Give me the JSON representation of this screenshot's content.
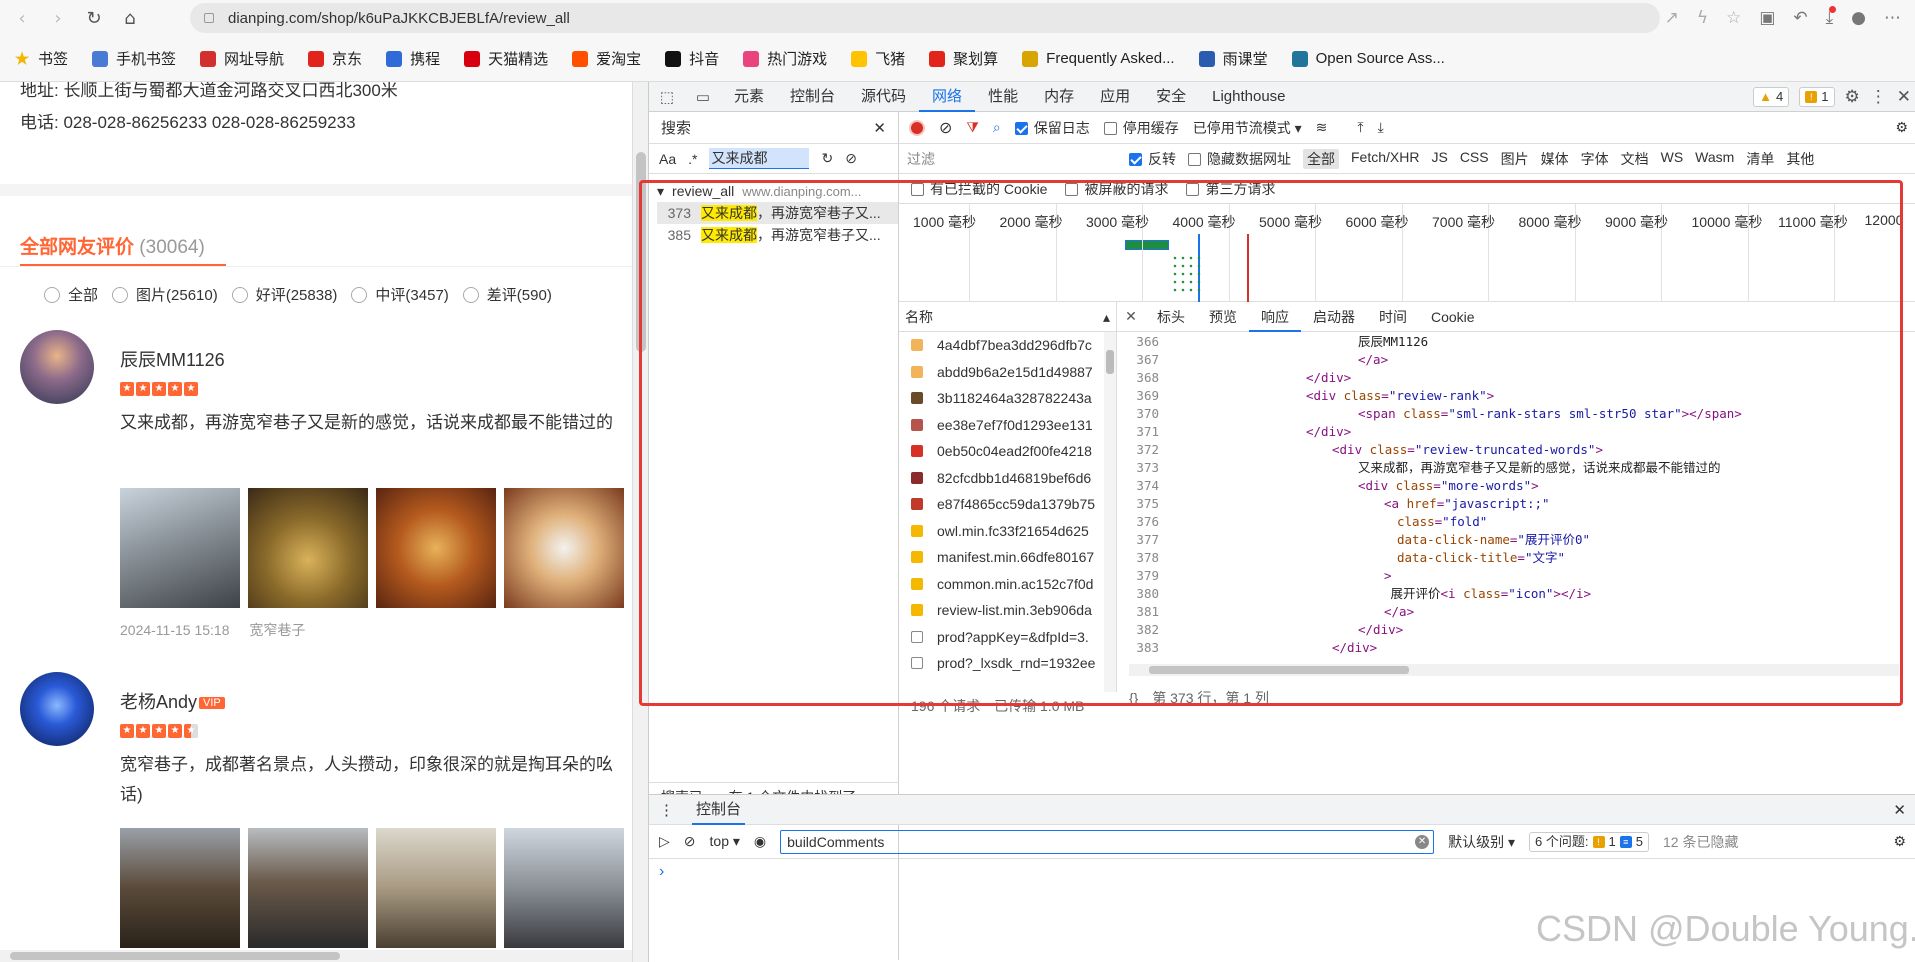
{
  "browser": {
    "url": "dianping.com/shop/k6uPaJKKCBJEBLfA/review_all",
    "bookmarks": [
      {
        "label": "书签",
        "color": "#f4b400"
      },
      {
        "label": "手机书签",
        "color": "#4a7bd4"
      },
      {
        "label": "网址导航",
        "color": "#d32f2f"
      },
      {
        "label": "京东",
        "color": "#e1251b"
      },
      {
        "label": "携程",
        "color": "#2f6bd8"
      },
      {
        "label": "天猫精选",
        "color": "#d8000f"
      },
      {
        "label": "爱淘宝",
        "color": "#ff5000"
      },
      {
        "label": "抖音",
        "color": "#111111"
      },
      {
        "label": "热门游戏",
        "color": "#e9447e"
      },
      {
        "label": "飞猪",
        "color": "#ffc300"
      },
      {
        "label": "聚划算",
        "color": "#e1251b"
      },
      {
        "label": "Frequently Asked...",
        "color": "#d8a400"
      },
      {
        "label": "雨课堂",
        "color": "#2a5db0"
      },
      {
        "label": "Open Source Ass...",
        "color": "#21759b"
      }
    ]
  },
  "page": {
    "address_line": "地址: 长顺上街与蜀都大道金河路交叉口西北300米",
    "phone_line": "电话: 028-028-86256233 028-028-86259233",
    "review_title": "全部网友评价",
    "review_count": "(30064)",
    "filters": [
      "全部",
      "图片(25610)",
      "好评(25838)",
      "中评(3457)",
      "差评(590)"
    ],
    "reviews": [
      {
        "user": "辰辰MM1126",
        "vip": "",
        "rating": 5,
        "text": "又来成都，再游宽窄巷子又是新的感觉，话说来成都最不能错过的",
        "text2": "",
        "date": "2024-11-15 15:18",
        "place": "宽窄巷子"
      },
      {
        "user": "老杨Andy",
        "vip": "VIP",
        "rating": 4.5,
        "text": "宽窄巷子，成都著名景点，人头攒动，印象很深的就是掏耳朵的吆",
        "text2": "话)",
        "date": "",
        "place": ""
      }
    ]
  },
  "devtools": {
    "tabs": [
      "元素",
      "控制台",
      "源代码",
      "网络",
      "性能",
      "内存",
      "应用",
      "安全",
      "Lighthouse"
    ],
    "active_tab": "网络",
    "warnings": "4",
    "issues": "1",
    "search": {
      "title": "搜索",
      "case_label": "Aa",
      "regex_label": ".*",
      "query": "又来成都",
      "file": "review_all",
      "domain": "www.dianping.com...",
      "hits": [
        {
          "line": "373",
          "match": "又来成都",
          "rest": "，再游宽窄巷子又..."
        },
        {
          "line": "385",
          "match": "又来成都",
          "rest": "，再游宽窄巷子又..."
        }
      ],
      "footer_a": "搜索已...",
      "footer_b": "在 1 个文件中找到了 ..."
    },
    "network": {
      "preserve_log": "保留日志",
      "disable_cache": "停用缓存",
      "throttle": "已停用节流模式",
      "filter_placeholder": "过滤",
      "invert": "反转",
      "hide_data_urls": "隐藏数据网址",
      "types": [
        "全部",
        "Fetch/XHR",
        "JS",
        "CSS",
        "图片",
        "媒体",
        "字体",
        "文档",
        "WS",
        "Wasm",
        "清单",
        "其他"
      ],
      "blocked_cookies": "有已拦截的 Cookie",
      "blocked_requests": "被屏蔽的请求",
      "third_party": "第三方请求",
      "timeline_ticks": [
        "1000 毫秒",
        "2000 毫秒",
        "3000 毫秒",
        "4000 毫秒",
        "5000 毫秒",
        "6000 毫秒",
        "7000 毫秒",
        "8000 毫秒",
        "9000 毫秒",
        "10000 毫秒",
        "11000 毫秒",
        "12000"
      ],
      "name_header": "名称",
      "requests": [
        {
          "name": "4a4dbf7bea3dd296dfb7c",
          "icon_color": "#f2b45a"
        },
        {
          "name": "abdd9b6a2e15d1d49887",
          "icon_color": "#f2b45a"
        },
        {
          "name": "3b1182464a328782243a",
          "icon_color": "#6b4a2a"
        },
        {
          "name": "ee38e7ef7f0d1293ee131",
          "icon_color": "#b5544a"
        },
        {
          "name": "0eb50c04ead2f00fe4218",
          "icon_color": "#d93025"
        },
        {
          "name": "82cfcdbb1d46819bef6d6",
          "icon_color": "#8a2c2c"
        },
        {
          "name": "e87f4865cc59da1379b75",
          "icon_color": "#c0392b"
        },
        {
          "name": "owl.min.fc33f21654d625",
          "icon_color": "#f5b800"
        },
        {
          "name": "manifest.min.66dfe80167",
          "icon_color": "#f5b800"
        },
        {
          "name": "common.min.ac152c7f0d",
          "icon_color": "#f5b800"
        },
        {
          "name": "review-list.min.3eb906da",
          "icon_color": "#f5b800"
        },
        {
          "name": "prod?appKey=&dfpId=3.",
          "icon_color": "#ffffff"
        },
        {
          "name": "prod?_lxsdk_rnd=1932ee",
          "icon_color": "#ffffff"
        }
      ],
      "status_a": "196 个请求",
      "status_b": "已传输 1.0 MB",
      "detail_tabs": [
        "标头",
        "预览",
        "响应",
        "启动器",
        "时间",
        "Cookie"
      ],
      "active_detail_tab": "响应",
      "cursor_pos": "第 373 行，第 1 列",
      "code_lines": [
        {
          "n": "366",
          "indent": 30,
          "parts": [
            [
              "tx",
              "辰辰MM1126"
            ]
          ]
        },
        {
          "n": "367",
          "indent": 30,
          "parts": [
            [
              "tg",
              "</a>"
            ]
          ]
        },
        {
          "n": "368",
          "indent": 22,
          "parts": [
            [
              "tg",
              "</div>"
            ]
          ]
        },
        {
          "n": "369",
          "indent": 22,
          "parts": [
            [
              "tg",
              "<div "
            ],
            [
              "at",
              "class"
            ],
            [
              "tg",
              "="
            ],
            [
              "av",
              "\"review-rank\""
            ],
            [
              "tg",
              ">"
            ]
          ]
        },
        {
          "n": "370",
          "indent": 30,
          "parts": [
            [
              "tg",
              "<span "
            ],
            [
              "at",
              "class"
            ],
            [
              "tg",
              "="
            ],
            [
              "av",
              "\"sml-rank-stars sml-str50 star\""
            ],
            [
              "tg",
              "></span>"
            ]
          ]
        },
        {
          "n": "371",
          "indent": 22,
          "parts": [
            [
              "tg",
              "</div>"
            ]
          ]
        },
        {
          "n": "372",
          "indent": 26,
          "parts": [
            [
              "tg",
              "<div "
            ],
            [
              "at",
              "class"
            ],
            [
              "tg",
              "="
            ],
            [
              "av",
              "\"review-truncated-words\""
            ],
            [
              "tg",
              ">"
            ]
          ]
        },
        {
          "n": "373",
          "indent": 30,
          "parts": [
            [
              "tx",
              "又来成都，再游宽窄巷子又是新的感觉，话说来成都最不能错过的"
            ]
          ]
        },
        {
          "n": "374",
          "indent": 30,
          "parts": [
            [
              "tg",
              "<div "
            ],
            [
              "at",
              "class"
            ],
            [
              "tg",
              "="
            ],
            [
              "av",
              "\"more-words\""
            ],
            [
              "tg",
              ">"
            ]
          ]
        },
        {
          "n": "375",
          "indent": 34,
          "parts": [
            [
              "tg",
              "<a "
            ],
            [
              "at",
              "href"
            ],
            [
              "tg",
              "="
            ],
            [
              "av",
              "\"javascript:;\""
            ]
          ]
        },
        {
          "n": "376",
          "indent": 36,
          "parts": [
            [
              "at",
              "class"
            ],
            [
              "tg",
              "="
            ],
            [
              "av",
              "\"fold\""
            ]
          ]
        },
        {
          "n": "377",
          "indent": 36,
          "parts": [
            [
              "at",
              "data-click-name"
            ],
            [
              "tg",
              "="
            ],
            [
              "av",
              "\"展开评价0\""
            ]
          ]
        },
        {
          "n": "378",
          "indent": 36,
          "parts": [
            [
              "at",
              "data-click-title"
            ],
            [
              "tg",
              "="
            ],
            [
              "av",
              "\"文字\""
            ]
          ]
        },
        {
          "n": "379",
          "indent": 34,
          "parts": [
            [
              "tg",
              ">"
            ]
          ]
        },
        {
          "n": "380",
          "indent": 35,
          "parts": [
            [
              "tx",
              "展开评价"
            ],
            [
              "tg",
              "<i "
            ],
            [
              "at",
              "class"
            ],
            [
              "tg",
              "="
            ],
            [
              "av",
              "\"icon\""
            ],
            [
              "tg",
              "></i>"
            ]
          ]
        },
        {
          "n": "381",
          "indent": 34,
          "parts": [
            [
              "tg",
              "</a>"
            ]
          ]
        },
        {
          "n": "382",
          "indent": 30,
          "parts": [
            [
              "tg",
              "</div>"
            ]
          ]
        },
        {
          "n": "383",
          "indent": 26,
          "parts": [
            [
              "tg",
              "</div>"
            ]
          ]
        }
      ]
    },
    "console": {
      "title": "控制台",
      "context": "top",
      "filter_value": "buildComments",
      "level": "默认级别",
      "issues_label": "6 个问题:",
      "issues_warn": "1",
      "issues_info": "5",
      "hidden": "12 条已隐藏",
      "prompt": "›"
    }
  },
  "watermark": "CSDN @Double Young."
}
